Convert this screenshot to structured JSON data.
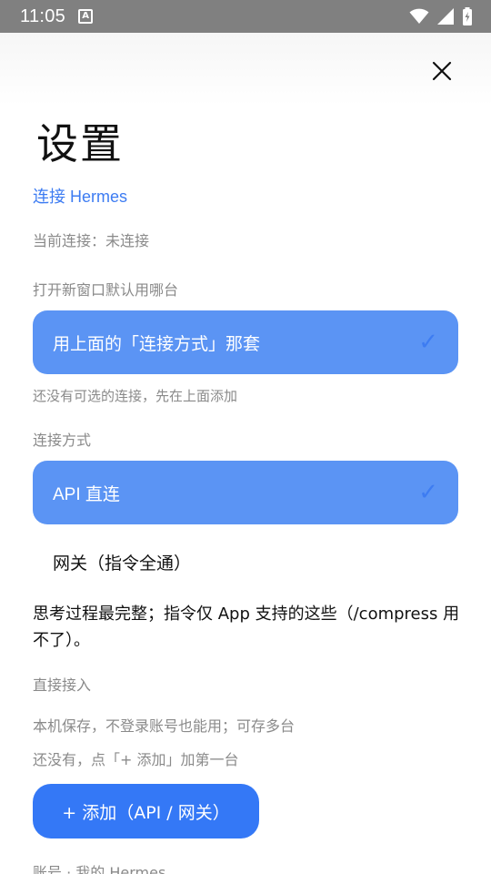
{
  "status_bar": {
    "time": "11:05",
    "notification_glyph": "A",
    "icons": [
      "wifi-icon",
      "signal-icon",
      "battery-charging-icon"
    ]
  },
  "header": {
    "close_icon": "close-icon",
    "title": "设置"
  },
  "connection": {
    "link_label": "连接 Hermes",
    "status": "当前连接：未连接"
  },
  "default_window": {
    "label": "打开新窗口默认用哪台",
    "selected_option": "用上面的「连接方式」那套",
    "hint": "还没有可选的连接，先在上面添加"
  },
  "connection_method": {
    "label": "连接方式",
    "options": [
      {
        "label": "API 直连",
        "selected": true
      },
      {
        "label": "网关（指令全通）",
        "selected": false
      }
    ],
    "description": "思考过程最完整；指令仅 App 支持的这些（/compress 用不了）。"
  },
  "direct_access": {
    "label": "直接接入",
    "note": "本机保存，不登录账号也能用；可存多台",
    "empty": "还没有，点「+ 添加」加第一台",
    "add_button": "+ 添加（API / 网关）"
  },
  "account": {
    "label": "账号 · 我的 Hermes"
  },
  "colors": {
    "accent": "#3478f6",
    "selected_card": "#5b94f4",
    "link": "#3d7cf2",
    "muted_text": "#8a8a8a",
    "status_bar": "#808080"
  }
}
